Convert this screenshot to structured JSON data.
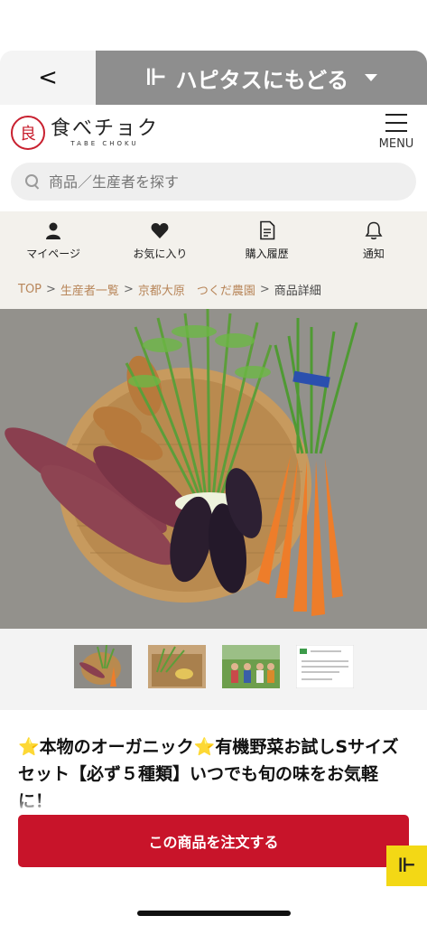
{
  "topbar": {
    "back_glyph": "<",
    "hapi_logo": "⊩",
    "hapi_label": "ハピタスにもどる"
  },
  "header": {
    "logo_mark": "良",
    "logo_main": "食べチョク",
    "logo_sub": "TABE CHOKU",
    "menu_label": "MENU"
  },
  "search": {
    "placeholder": "商品／生産者を探す"
  },
  "nav": {
    "items": [
      {
        "label": "マイページ",
        "icon": "person-icon"
      },
      {
        "label": "お気に入り",
        "icon": "heart-icon"
      },
      {
        "label": "購入履歴",
        "icon": "receipt-icon"
      },
      {
        "label": "通知",
        "icon": "bell-icon"
      }
    ]
  },
  "breadcrumb": {
    "items": [
      "TOP",
      "生産者一覧",
      "京都大原　つくだ農園"
    ],
    "current": "商品詳細"
  },
  "product": {
    "title_part1": "本物のオーガニック",
    "title_part2": "有機野菜お試しSサイズセット【必ず５種類】いつでも旬の味をお気軽に！",
    "star_glyph": "⭐"
  },
  "order": {
    "label": "この商品を注文する"
  },
  "float_button": {
    "glyph": "⊩"
  },
  "colors": {
    "brand_red": "#c8142a",
    "hapi_grey": "#8e8e8e",
    "breadcrumb_link": "#b8865a",
    "hapi_yellow": "#f3d815"
  }
}
